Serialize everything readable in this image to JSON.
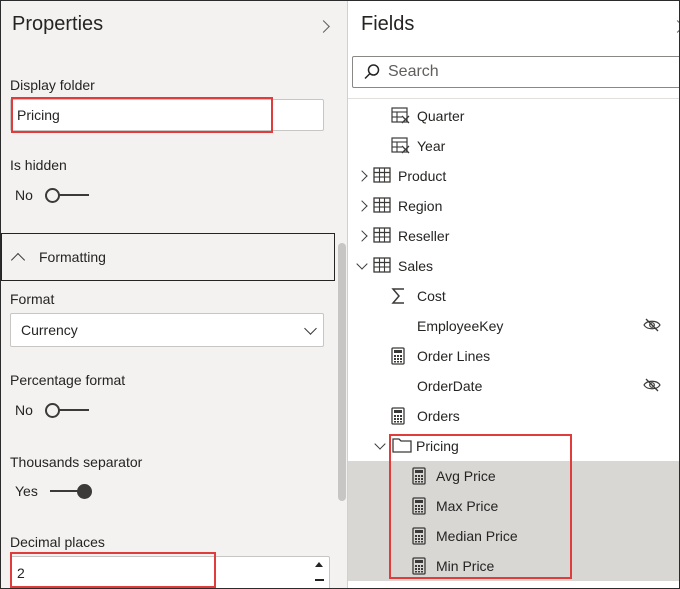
{
  "properties": {
    "title": "Properties",
    "display_folder": {
      "label": "Display folder",
      "value": "Pricing"
    },
    "is_hidden": {
      "label": "Is hidden",
      "state": "No"
    },
    "formatting": {
      "label": "Formatting"
    },
    "format": {
      "label": "Format",
      "value": "Currency"
    },
    "percentage_format": {
      "label": "Percentage format",
      "state": "No"
    },
    "thousands_separator": {
      "label": "Thousands separator",
      "state": "Yes"
    },
    "decimal_places": {
      "label": "Decimal places",
      "value": "2"
    }
  },
  "fields": {
    "title": "Fields",
    "search": {
      "placeholder": "Search"
    },
    "tree": [
      {
        "label": "Quarter",
        "icon": "hierarchy-field-icon",
        "selected": false
      },
      {
        "label": "Year",
        "icon": "hierarchy-field-icon",
        "selected": false
      },
      {
        "label": "Product",
        "icon": "table-icon",
        "expander": "collapsed",
        "selected": false
      },
      {
        "label": "Region",
        "icon": "table-icon",
        "expander": "collapsed",
        "selected": false
      },
      {
        "label": "Reseller",
        "icon": "table-icon",
        "expander": "collapsed",
        "selected": false
      },
      {
        "label": "Sales",
        "icon": "table-icon",
        "expander": "expanded",
        "selected": false
      },
      {
        "label": "Cost",
        "icon": "sigma-icon",
        "selected": false
      },
      {
        "label": "EmployeeKey",
        "icon": "none",
        "hidden_icon": "eye-hidden-icon",
        "selected": false
      },
      {
        "label": "Order Lines",
        "icon": "calculator-icon",
        "selected": false
      },
      {
        "label": "OrderDate",
        "icon": "none",
        "hidden_icon": "eye-hidden-icon",
        "selected": false
      },
      {
        "label": "Orders",
        "icon": "calculator-icon",
        "selected": false
      },
      {
        "label": "Pricing",
        "icon": "folder-icon",
        "expander": "expanded",
        "selected": false
      },
      {
        "label": "Avg Price",
        "icon": "calculator-icon",
        "selected": true
      },
      {
        "label": "Max Price",
        "icon": "calculator-icon",
        "selected": true
      },
      {
        "label": "Median Price",
        "icon": "calculator-icon",
        "selected": true
      },
      {
        "label": "Min Price",
        "icon": "calculator-icon",
        "selected": true
      }
    ]
  },
  "colors": {
    "highlight_box": "#e03c3c",
    "selected_row": "#d9d7d3",
    "left_pane_bg": "#f3f2f1"
  }
}
